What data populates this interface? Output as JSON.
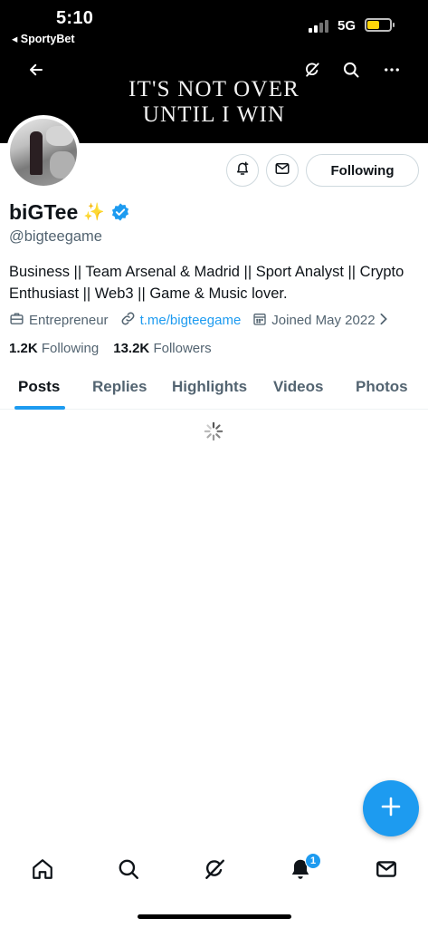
{
  "status_bar": {
    "time": "5:10",
    "back_app": "◂ SportyBet",
    "network": "5G"
  },
  "banner": {
    "line1": "IT'S NOT OVER",
    "line2": "UNTIL I WIN",
    "icons": [
      "back-arrow-icon",
      "grok-icon",
      "search-icon",
      "more-icon"
    ]
  },
  "actions": {
    "notify_icon": "bell-plus-icon",
    "message_icon": "envelope-icon",
    "following_label": "Following"
  },
  "profile": {
    "display_name": "biGTee",
    "sparkle": "✨",
    "handle": "@bigteegame",
    "bio": "Business || Team Arsenal & Madrid || Sport Analyst || Crypto Enthusiast || Web3 || Game & Music lover.",
    "category": "Entrepreneur",
    "link": "t.me/bigteegame",
    "joined": "Joined May 2022",
    "following_count": "1.2K",
    "following_label": "Following",
    "followers_count": "13.2K",
    "followers_label": "Followers"
  },
  "tabs": [
    {
      "label": "Posts",
      "active": true
    },
    {
      "label": "Replies",
      "active": false
    },
    {
      "label": "Highlights",
      "active": false
    },
    {
      "label": "Videos",
      "active": false
    },
    {
      "label": "Photos",
      "active": false
    }
  ],
  "bottom_nav": {
    "icons": [
      "home-icon",
      "search-icon",
      "grok-icon",
      "bell-icon",
      "mail-icon"
    ],
    "notification_badge": "1"
  },
  "colors": {
    "accent": "#1d9bf0",
    "text_primary": "#0f1419",
    "text_secondary": "#536471",
    "border": "#cfd9de"
  }
}
